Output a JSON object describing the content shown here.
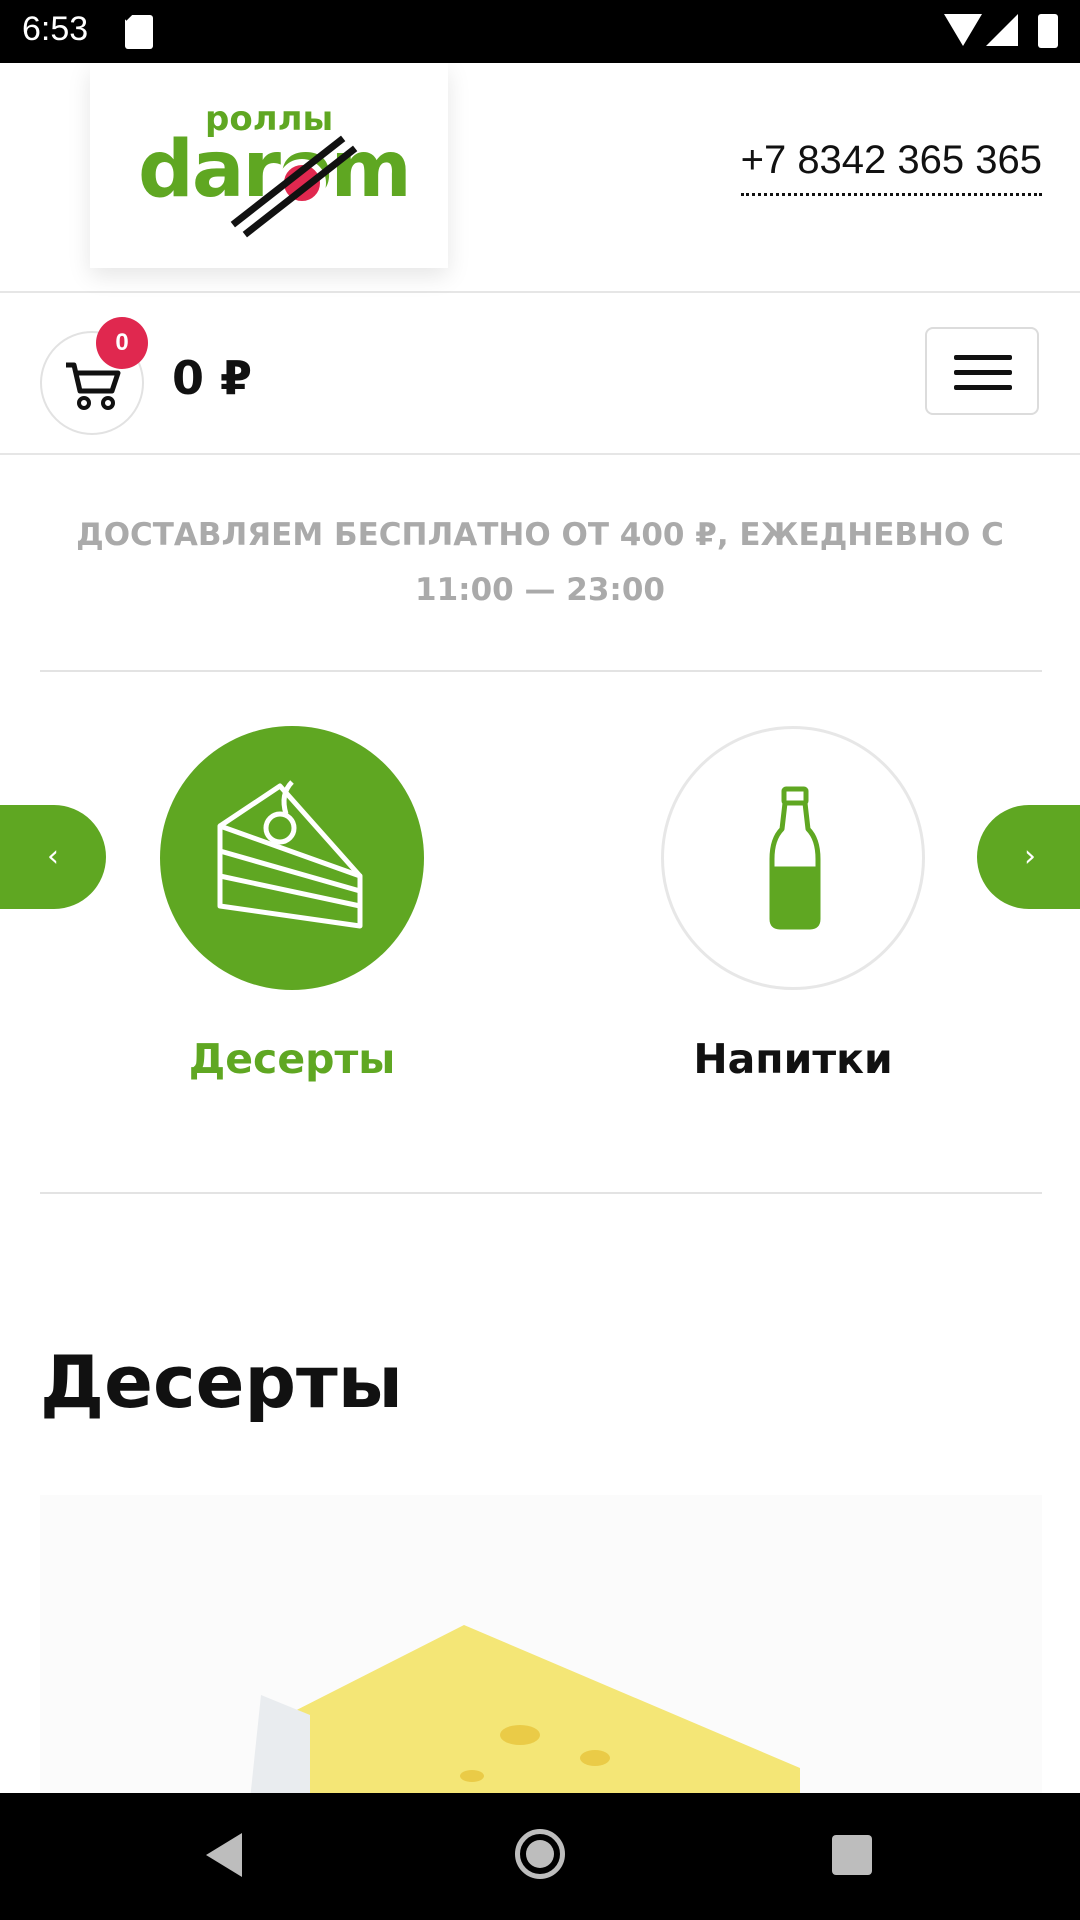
{
  "status_bar": {
    "time": "6:53"
  },
  "brand": {
    "logo_small": "роллы",
    "logo_big": "darom",
    "phone": "+7 8342 365 365"
  },
  "cart": {
    "count": "0",
    "total": "0 ₽"
  },
  "delivery": {
    "line1": "ДОСТАВЛЯЕМ БЕСПЛАТНО ОТ 400 ₽, ЕЖЕДНЕВНО С",
    "line2": "11:00 — 23:00"
  },
  "carousel": {
    "prev_label": "‹",
    "next_label": "›",
    "categories": [
      {
        "label": "Десерты",
        "icon": "cake-icon",
        "active": true
      },
      {
        "label": "Напитки",
        "icon": "bottle-icon",
        "active": false
      }
    ]
  },
  "section": {
    "title": "Десерты"
  },
  "colors": {
    "accent": "#5fa722",
    "badge": "#e0284f",
    "muted_text": "#aaaaaa"
  }
}
